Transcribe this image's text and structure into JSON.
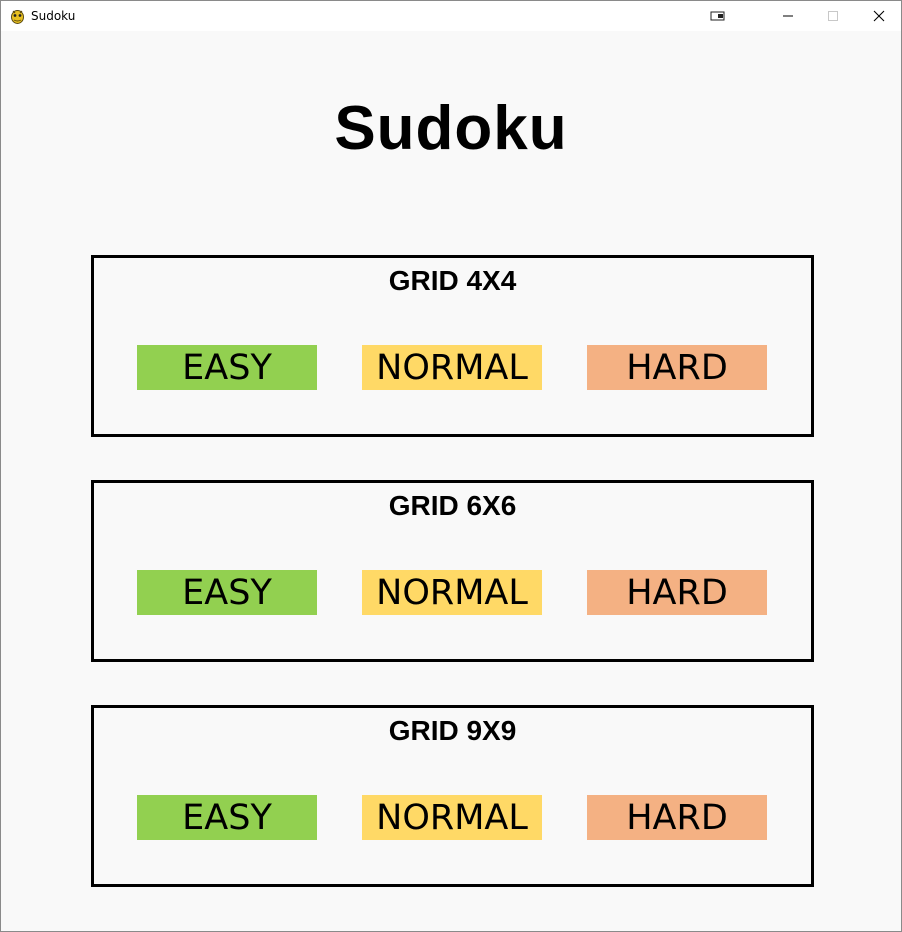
{
  "window": {
    "title": "Sudoku"
  },
  "main": {
    "title": "Sudoku"
  },
  "grids": [
    {
      "label": "GRID 4X4",
      "buttons": [
        {
          "label": "EASY"
        },
        {
          "label": "NORMAL"
        },
        {
          "label": "HARD"
        }
      ]
    },
    {
      "label": "GRID 6X6",
      "buttons": [
        {
          "label": "EASY"
        },
        {
          "label": "NORMAL"
        },
        {
          "label": "HARD"
        }
      ]
    },
    {
      "label": "GRID 9X9",
      "buttons": [
        {
          "label": "EASY"
        },
        {
          "label": "NORMAL"
        },
        {
          "label": "HARD"
        }
      ]
    }
  ],
  "colors": {
    "easy": "#92d050",
    "normal": "#ffd966",
    "hard": "#f4b183",
    "background": "#f9f9f9",
    "border": "#000000"
  },
  "icons": {
    "app": "pygame-snake-icon",
    "extra": "window-snap-icon",
    "minimize": "minimize-icon",
    "maximize": "maximize-icon",
    "close": "close-icon"
  }
}
